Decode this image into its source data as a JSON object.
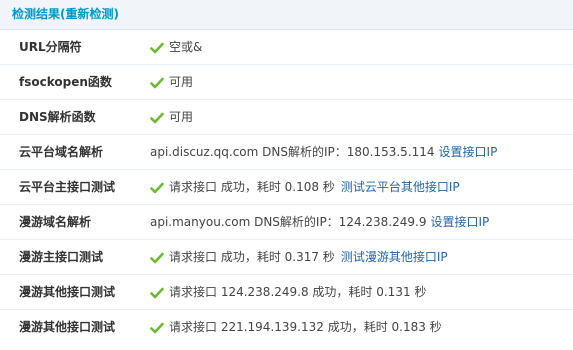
{
  "header": {
    "title": "检测结果(重新检测)"
  },
  "colors": {
    "title": "#0099cc",
    "check": "#6fba2c",
    "link": "#2366a8",
    "header_bg": "#f1f5fa"
  },
  "rows": [
    {
      "label": "URL分隔符",
      "icon": "check-icon",
      "text": "空或&"
    },
    {
      "label": "fsockopen函数",
      "icon": "check-icon",
      "text": "可用"
    },
    {
      "label": "DNS解析函数",
      "icon": "check-icon",
      "text": "可用"
    },
    {
      "label": "云平台域名解析",
      "icon": null,
      "text": "api.discuz.qq.com DNS解析的IP：180.153.5.114",
      "link": "设置接口IP"
    },
    {
      "label": "云平台主接口测试",
      "icon": "check-icon",
      "text": "请求接口 成功，耗时 0.108 秒",
      "link": "测试云平台其他接口IP"
    },
    {
      "label": "漫游域名解析",
      "icon": null,
      "text": "api.manyou.com DNS解析的IP：124.238.249.9",
      "link": "设置接口IP"
    },
    {
      "label": "漫游主接口测试",
      "icon": "check-icon",
      "text": "请求接口 成功，耗时 0.317 秒",
      "link": "测试漫游其他接口IP"
    },
    {
      "label": "漫游其他接口测试",
      "icon": "check-icon",
      "text": "请求接口 124.238.249.8 成功，耗时 0.131 秒"
    },
    {
      "label": "漫游其他接口测试",
      "icon": "check-icon",
      "text": "请求接口 221.194.139.132 成功，耗时 0.183 秒"
    }
  ]
}
